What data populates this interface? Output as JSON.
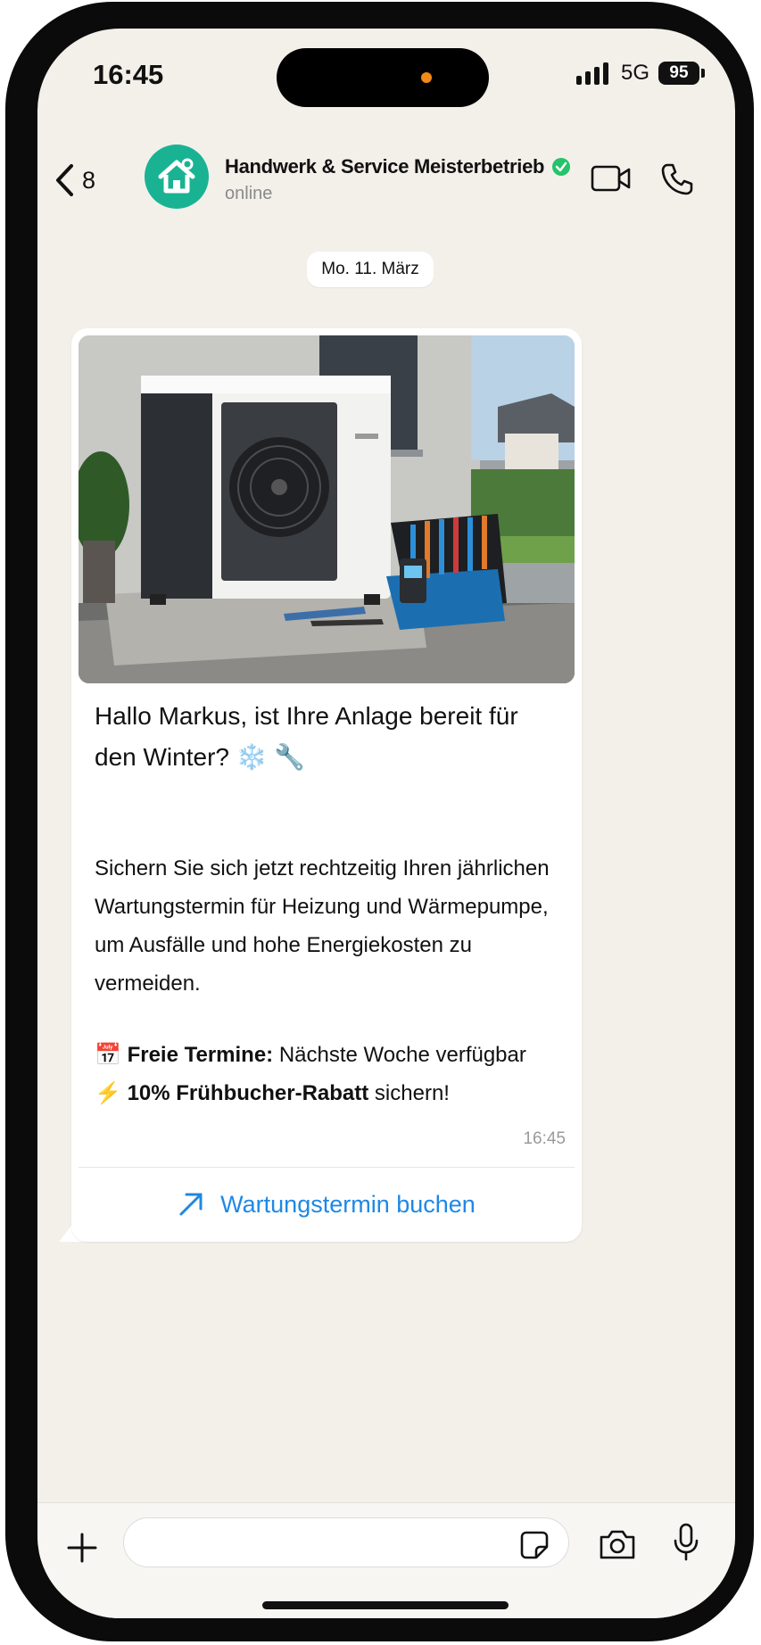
{
  "status_bar": {
    "time": "16:45",
    "network": "5G",
    "battery": "95"
  },
  "header": {
    "back_count": "8",
    "contact_name": "Handwerk & Service Meisterbetrieb",
    "contact_status": "online"
  },
  "chat": {
    "date_chip": "Mo. 11. März",
    "message": {
      "title": "Hallo Markus, ist Ihre Anlage bereit für den Winter? ❄️ 🔧",
      "body": "Sichern Sie sich jetzt rechtzeitig Ihren jährlichen Wartungstermin für Heizung und Wärmepumpe, um Ausfälle und hohe Energiekosten zu vermeiden.",
      "line1_emoji": "📅",
      "line1_bold": "Freie Termine:",
      "line1_text": " Nächste Woche verfügbar",
      "line2_emoji": "⚡",
      "line2_bold": "10% Frühbucher-Rabatt",
      "line2_text": " sichern!",
      "time": "16:45",
      "cta_label": "Wartungstermin buchen"
    }
  },
  "composer": {
    "placeholder": ""
  },
  "colors": {
    "accent_green": "#19b394",
    "link_blue": "#1e88e5",
    "chat_background": "#f3f0ea",
    "verified_green": "#25c36a"
  },
  "icons": [
    "back-chevron-icon",
    "home-wrench-icon",
    "verified-badge-icon",
    "video-call-icon",
    "phone-call-icon",
    "arrow-up-right-icon",
    "plus-icon",
    "sticker-icon",
    "camera-icon",
    "microphone-icon"
  ]
}
